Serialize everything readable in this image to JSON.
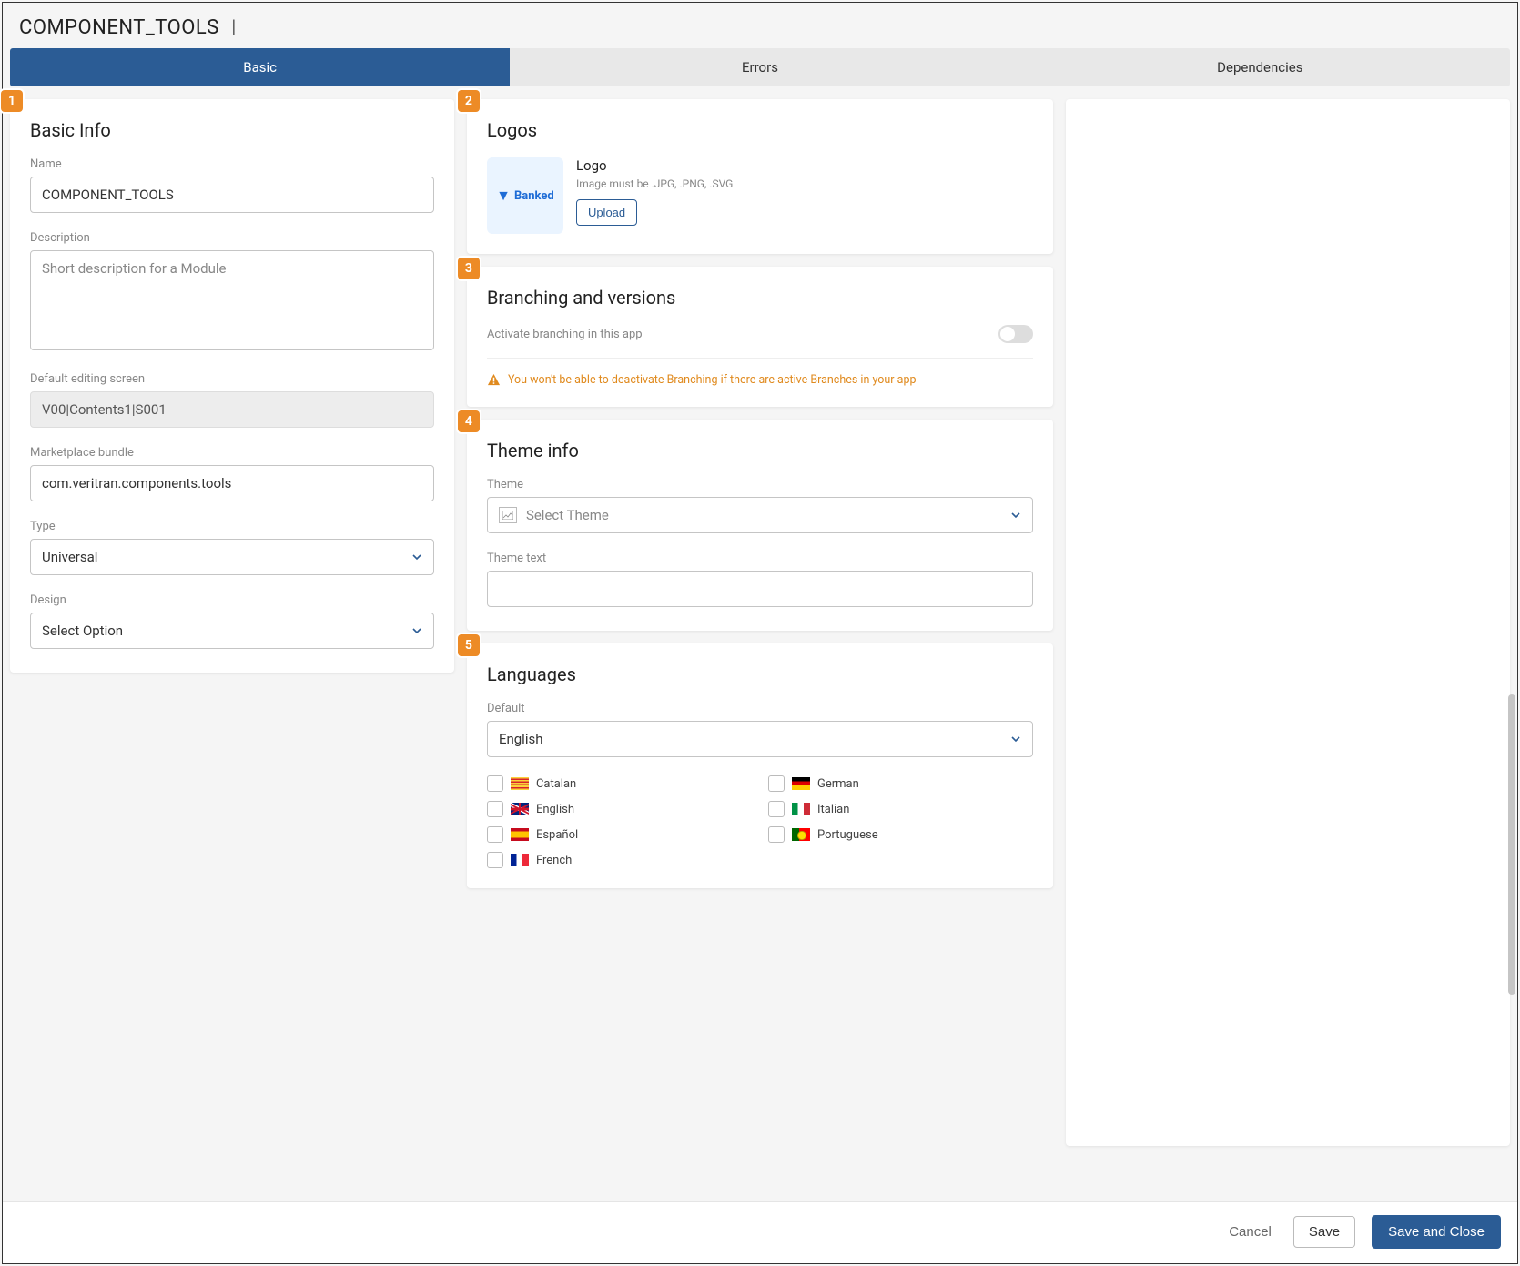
{
  "header": {
    "title": "COMPONENT_TOOLS",
    "pipe": "|"
  },
  "tabs": {
    "basic": "Basic",
    "errors": "Errors",
    "dependencies": "Dependencies"
  },
  "badges": {
    "c1": "1",
    "c2": "2",
    "c3": "3",
    "c4": "4",
    "c5": "5"
  },
  "basicInfo": {
    "heading": "Basic Info",
    "name_label": "Name",
    "name_value": "COMPONENT_TOOLS",
    "description_label": "Description",
    "description_placeholder": "Short description for a Module",
    "default_screen_label": "Default editing screen",
    "default_screen_value": "V00|Contents1|S001",
    "bundle_label": "Marketplace bundle",
    "bundle_value": "com.veritran.components.tools",
    "type_label": "Type",
    "type_value": "Universal",
    "design_label": "Design",
    "design_value": "Select Option"
  },
  "logos": {
    "heading": "Logos",
    "thumb_text": "Banked",
    "label": "Logo",
    "hint": "Image must be .JPG, .PNG, .SVG",
    "upload": "Upload"
  },
  "branching": {
    "heading": "Branching and versions",
    "toggle_label": "Activate branching in this app",
    "warning": "You won't be able to deactivate Branching if there are active Branches in your app"
  },
  "theme": {
    "heading": "Theme info",
    "theme_label": "Theme",
    "theme_placeholder": "Select Theme",
    "text_label": "Theme text"
  },
  "languages": {
    "heading": "Languages",
    "default_label": "Default",
    "default_value": "English",
    "items": {
      "catalan": "Catalan",
      "english": "English",
      "spanish": "Español",
      "french": "French",
      "german": "German",
      "italian": "Italian",
      "portuguese": "Portuguese"
    }
  },
  "footer": {
    "cancel": "Cancel",
    "save": "Save",
    "save_close": "Save and Close"
  }
}
